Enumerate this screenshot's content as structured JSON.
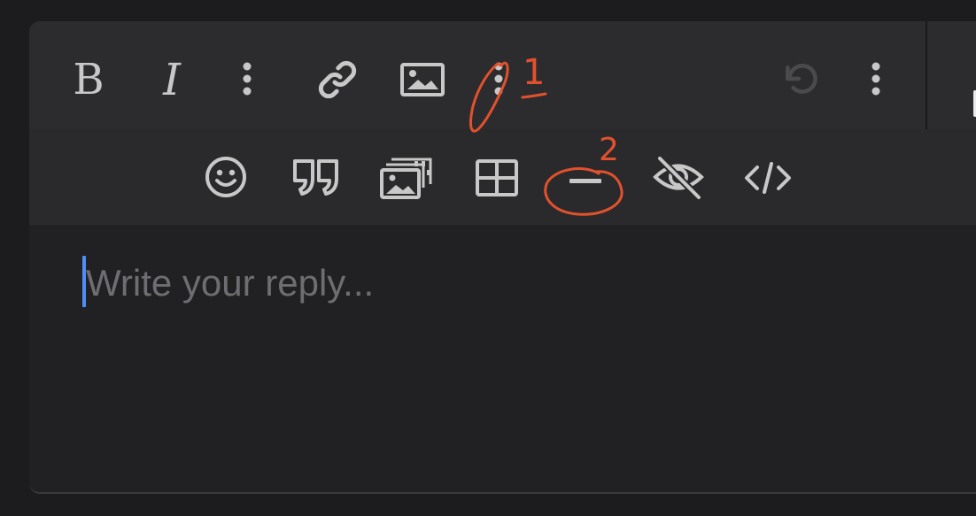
{
  "toolbar": {
    "bold": {
      "label": "B",
      "icon": "bold-icon"
    },
    "italic": {
      "label": "I",
      "icon": "italic-icon"
    },
    "more_format": {
      "icon": "vertical-ellipsis-icon"
    },
    "link": {
      "icon": "link-icon"
    },
    "image": {
      "icon": "image-icon"
    },
    "more_insert": {
      "icon": "vertical-ellipsis-icon"
    },
    "undo": {
      "icon": "undo-icon",
      "state": "disabled"
    },
    "overflow": {
      "icon": "vertical-ellipsis-icon"
    }
  },
  "toolbar_expanded": {
    "items": [
      {
        "name": "emoji",
        "icon": "emoji-icon"
      },
      {
        "name": "quote",
        "icon": "quote-icon"
      },
      {
        "name": "gallery",
        "icon": "image-gallery-icon"
      },
      {
        "name": "table",
        "icon": "table-icon"
      },
      {
        "name": "horizontal-rule",
        "icon": "horizontal-rule-icon"
      },
      {
        "name": "spoiler",
        "icon": "eye-slash-icon"
      },
      {
        "name": "code",
        "icon": "code-icon"
      }
    ]
  },
  "editor": {
    "placeholder": "Write your reply..."
  },
  "annotations": {
    "label_1": "1",
    "label_2": "2",
    "color": "#e2512d"
  },
  "colors": {
    "background": "#1c1c1e",
    "toolbar": "#2c2c2e",
    "toolbar_expanded": "#2a2a2c",
    "icon": "#c8c8c8",
    "caret": "#4f8ef7",
    "placeholder": "#6e6e72"
  }
}
